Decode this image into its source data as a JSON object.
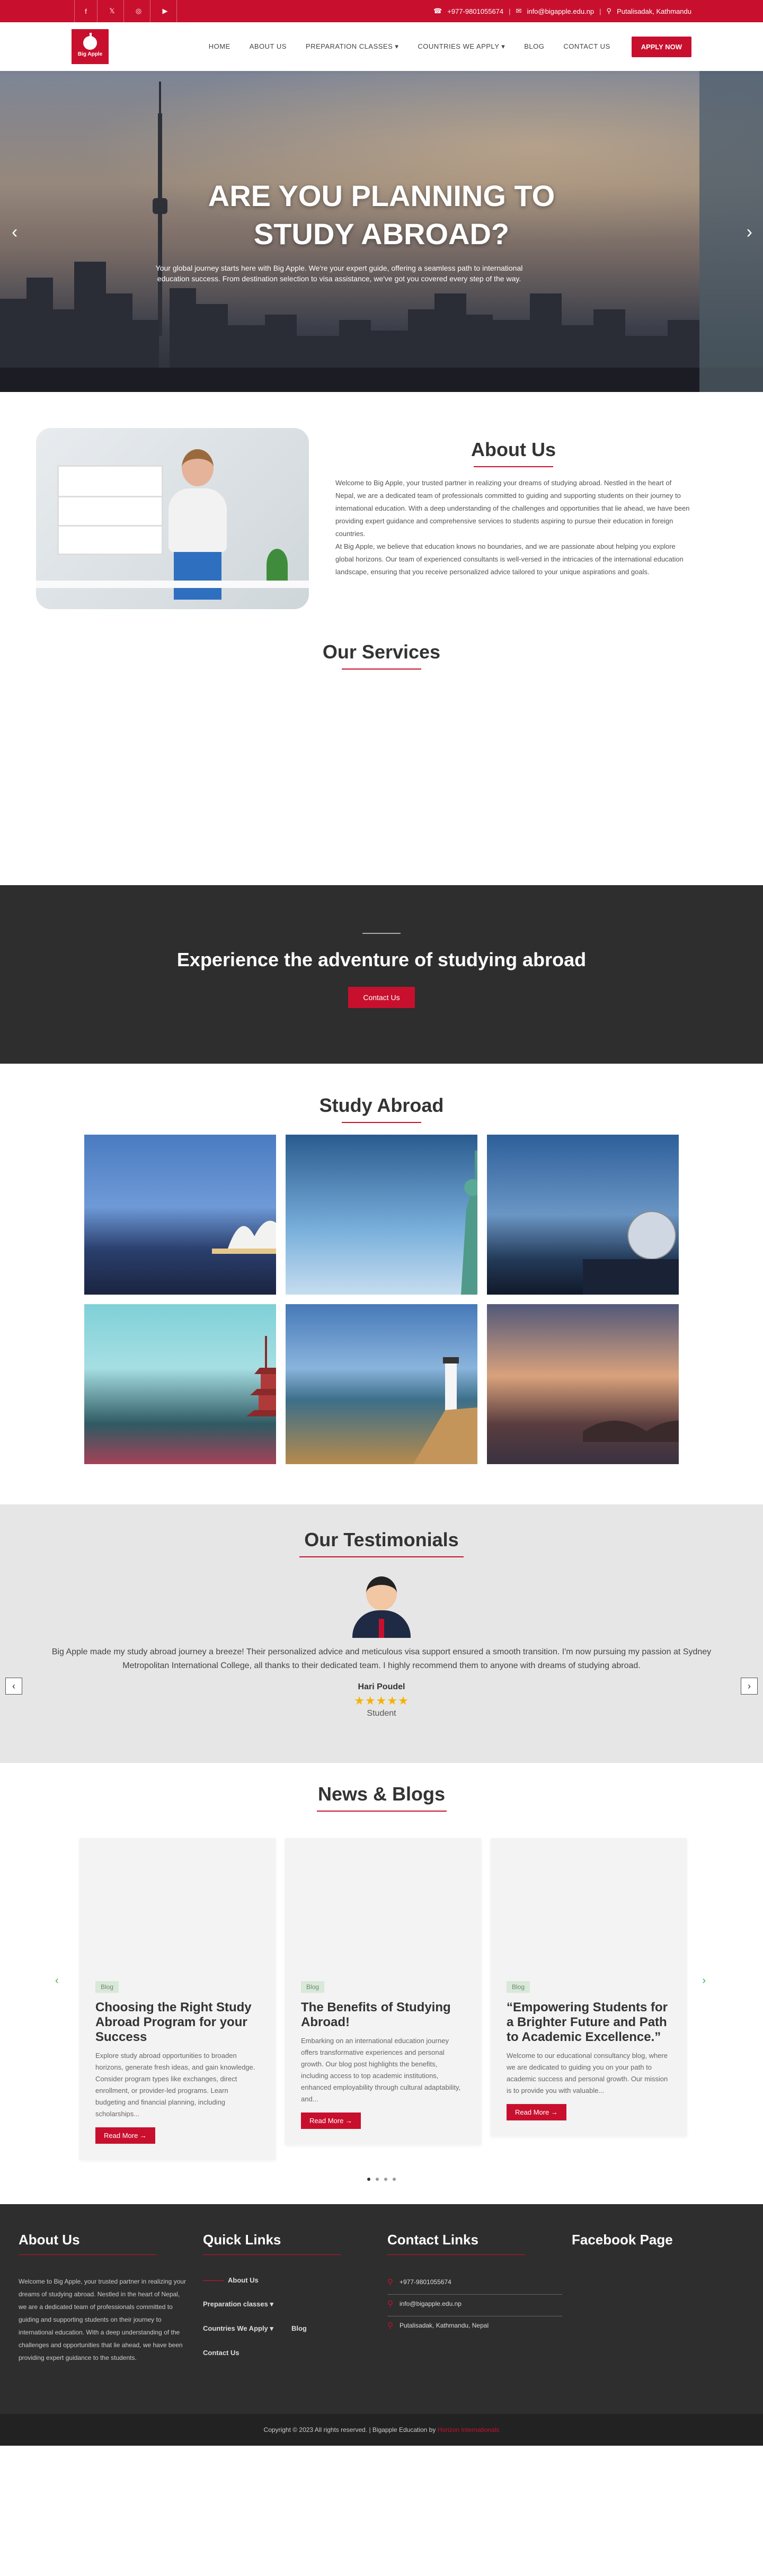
{
  "topbar": {
    "phone": "+977-9801055674",
    "email": "info@bigapple.edu.np",
    "location": "Putalisadak, Kathmandu"
  },
  "nav": {
    "logo_text": "Big Apple",
    "items": [
      "HOME",
      "ABOUT US",
      "PREPARATION CLASSES ▾",
      "COUNTRIES WE APPLY ▾",
      "BLOG",
      "CONTACT US"
    ],
    "apply": "APPLY NOW"
  },
  "hero": {
    "title_line1": "ARE YOU PLANNING TO",
    "title_line2": "STUDY ABROAD?",
    "subtitle": "Your global journey starts here with Big Apple. We're your expert guide, offering a seamless path to international education success. From destination selection to visa assistance, we've got you covered every step of the way."
  },
  "about": {
    "title": "About Us",
    "p1": "Welcome to Big Apple, your trusted partner in realizing your dreams of studying abroad. Nestled in the heart of Nepal, we are a dedicated team of professionals committed to guiding and supporting students on their journey to international education. With a deep understanding of the challenges and opportunities that lie ahead, we have been providing expert guidance and comprehensive services to students aspiring to pursue their education in foreign countries.",
    "p2": "At Big Apple, we believe that education knows no boundaries, and we are passionate about helping you explore global horizons. Our team of experienced consultants is well-versed in the intricacies of the international education landscape, ensuring that you receive personalized advice tailored to your unique aspirations and goals."
  },
  "services": {
    "title": "Our Services"
  },
  "cta": {
    "title": "Experience the adventure of studying abroad",
    "button": "Contact Us"
  },
  "study": {
    "title": "Study Abroad"
  },
  "testimonials": {
    "title": "Our Testimonials",
    "quote": "Big Apple made my study abroad journey a breeze! Their personalized advice and meticulous visa support ensured a smooth transition. I'm now pursuing my passion at Sydney Metropolitan International College, all thanks to their dedicated team. I highly recommend them to anyone with dreams of studying abroad.",
    "name": "Hari Poudel",
    "stars": "★★★★★",
    "role": "Student"
  },
  "blogs": {
    "title": "News & Blogs",
    "cards": [
      {
        "badge": "Blog",
        "title": "Choosing the Right Study Abroad Program for your Success",
        "excerpt": "Explore study abroad opportunities to broaden horizons, generate fresh ideas, and gain knowledge. Consider program types like exchanges, direct enrollment, or provider-led programs. Learn budgeting and financial planning, including scholarships...",
        "more": "Read More →"
      },
      {
        "badge": "Blog",
        "title": "The Benefits of Studying Abroad!",
        "excerpt": "Embarking on an international education journey offers transformative experiences and personal growth. Our blog post highlights the benefits, including access to top academic institutions, enhanced employability through cultural adaptability, and...",
        "more": "Read More →"
      },
      {
        "badge": "Blog",
        "title": "“Empowering Students for a Brighter Future and Path to Academic Excellence.”",
        "excerpt": "Welcome to our educational consultancy blog, where we are dedicated to guiding you on your path to academic success and personal growth. Our mission is to provide you with valuable...",
        "more": "Read More →"
      }
    ]
  },
  "footer": {
    "about_title": "About Us",
    "about_text": "Welcome to Big Apple, your trusted partner in realizing your dreams of studying abroad. Nestled in the heart of Nepal, we are a dedicated team of professionals committed to guiding and supporting students on their journey to international education. With a deep understanding of the challenges and opportunities that lie ahead, we have been providing expert guidance to the students.",
    "links_title": "Quick Links",
    "links": {
      "about": "About Us",
      "prep": "Preparation classes ▾",
      "countries": "Countries We Apply ▾",
      "blog": "Blog",
      "contact": "Contact Us"
    },
    "contact_title": "Contact Links",
    "phone": "+977-9801055674",
    "email": "info@bigapple.edu.np",
    "address": "Putalisadak, Kathmandu, Nepal",
    "fb_title": "Facebook Page"
  },
  "copyright": {
    "text": "Copyright © 2023 All rights reserved. | Bigapple Education by ",
    "brand": "Horizon Internationals"
  },
  "colors": {
    "primary": "#c8102e",
    "dark": "#2e2e2e",
    "accent_green": "#3cb24a"
  }
}
